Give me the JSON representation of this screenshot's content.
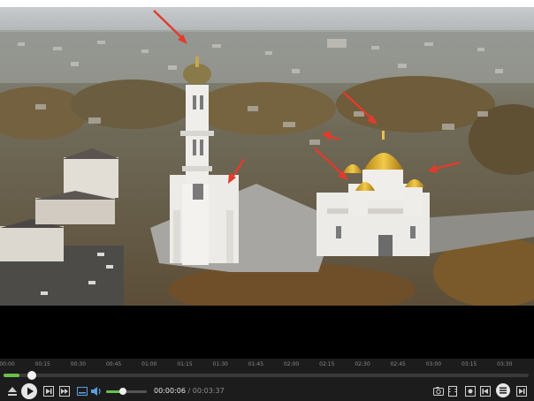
{
  "timeline": {
    "labels": [
      "00:00",
      "00:15",
      "00:30",
      "00:45",
      "01:00",
      "01:15",
      "01:30",
      "01:45",
      "02:00",
      "02:15",
      "02:30",
      "02:45",
      "03:00",
      "03:15",
      "03:30"
    ],
    "progress": 0.03
  },
  "playback": {
    "current": "00:00:06",
    "separator": "/",
    "total": "00:03:37",
    "volume": 0.42
  },
  "icons": {
    "left": [
      "eject-icon",
      "play-icon",
      "step-forward-icon",
      "fast-forward-icon",
      "subtitle-icon",
      "volume-icon"
    ],
    "right": [
      "screenshot-icon",
      "film-icon",
      "settings-icon",
      "previous-icon",
      "playlist-icon",
      "next-icon"
    ]
  },
  "colors": {
    "accent": "#6cc04a",
    "arrow": "#e23b2c",
    "gold": "#d9a928",
    "controls_bg": "#1c1c1c"
  }
}
